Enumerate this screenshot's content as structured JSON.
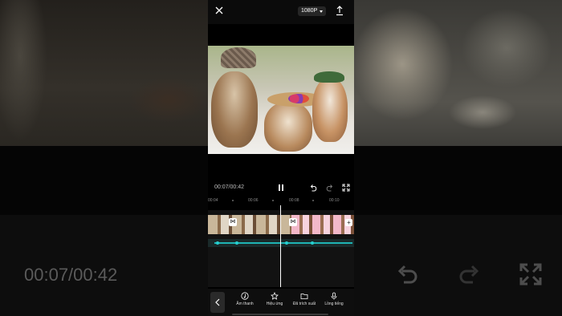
{
  "topbar": {
    "resolution": "1080P"
  },
  "player": {
    "timecode": "00:07/00:42"
  },
  "ruler": {
    "labels": [
      "00:04",
      "00:06",
      "00:08",
      "00:10"
    ]
  },
  "toolbar": {
    "items": [
      {
        "label": "Âm thanh",
        "icon": "music-note-icon"
      },
      {
        "label": "Hiệu ứng",
        "icon": "effects-star-icon"
      },
      {
        "label": "Đã trích xuất",
        "icon": "extracted-folder-icon"
      },
      {
        "label": "Lồng tiếng",
        "icon": "microphone-icon"
      }
    ]
  },
  "background": {
    "timecode": "00:07/00:42"
  },
  "colors": {
    "accent_audio": "#1fb3b3",
    "clip_pink": "#f2b8c9"
  }
}
